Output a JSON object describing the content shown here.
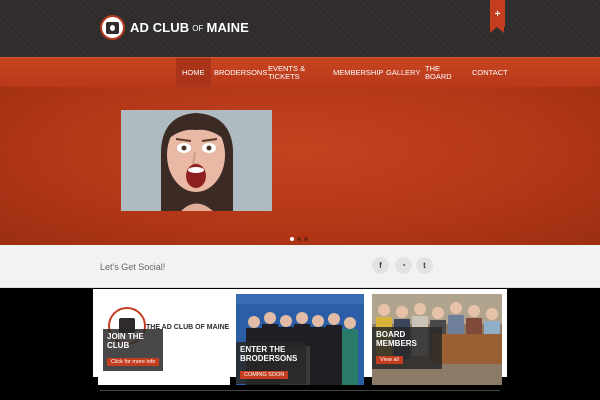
{
  "header": {
    "logo_main": "AD CLUB",
    "logo_of": "OF",
    "logo_state": "MAINE",
    "ribbon_label": "+"
  },
  "nav": {
    "items": [
      {
        "label": "HOME",
        "active": true
      },
      {
        "label": "BRODERSONS"
      },
      {
        "label": "EVENTS & TICKETS"
      },
      {
        "label": "MEMBERSHIP"
      },
      {
        "label": "GALLERY"
      },
      {
        "label": "THE BOARD"
      },
      {
        "label": "CONTACT"
      }
    ]
  },
  "hero": {
    "slide_count": 3,
    "active_slide": 1
  },
  "social": {
    "title": "Let's Get Social!",
    "icons": [
      "facebook-icon",
      "rss-icon",
      "twitter-icon"
    ],
    "glyphs": [
      "f",
      "◔",
      "t"
    ]
  },
  "cards": [
    {
      "title": "JOIN THE CLUB",
      "button": "Click for more info",
      "logo_text": "THE AD CLUB OF MAINE"
    },
    {
      "title": "ENTER THE BRODERSONS",
      "button": "COMING SOON"
    },
    {
      "title": "BOARD MEMBERS",
      "button": "View all"
    }
  ],
  "colors": {
    "accent": "#c43d1f",
    "header_bg": "#2e2b2a",
    "hero_bg": "#b23617",
    "social_bg": "#f2f2f2"
  }
}
